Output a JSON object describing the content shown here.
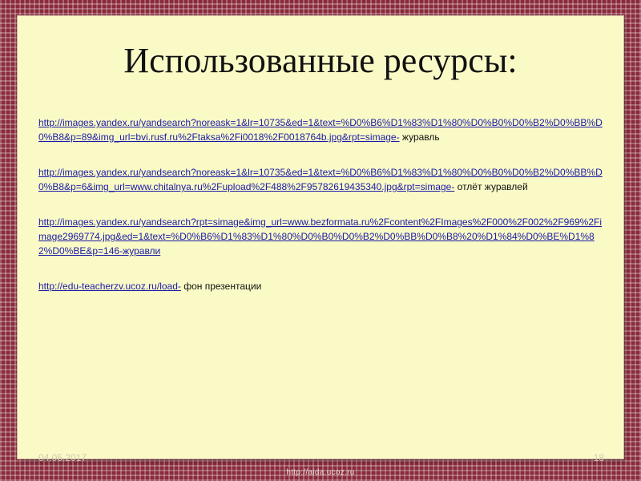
{
  "slide": {
    "title": "Использованные ресурсы:",
    "entries": [
      {
        "url": "http://images.yandex.ru/yandsearch?noreask=1&lr=10735&ed=1&text=%D0%B6%D1%83%D1%80%D0%B0%D0%B2%D0%BB%D0%B8&p=89&img_url=bvi.rusf.ru%2Ftaksa%2Fi0018%2F0018764b.jpg&rpt=simage-",
        "desc": " журавль"
      },
      {
        "url": "http://images.yandex.ru/yandsearch?noreask=1&lr=10735&ed=1&text=%D0%B6%D1%83%D1%80%D0%B0%D0%B2%D0%BB%D0%B8&p=6&img_url=www.chitalnya.ru%2Fupload%2F488%2F95782619435340.jpg&rpt=simage-",
        "desc": " отлёт журавлей"
      },
      {
        "url": "http://images.yandex.ru/yandsearch?rpt=simage&img_url=www.bezformata.ru%2Fcontent%2FImages%2F000%2F002%2F969%2Fimage2969774.jpg&ed=1&text=%D0%B6%D1%83%D1%80%D0%B0%D0%B2%D0%BB%D0%B8%20%D1%84%D0%BE%D1%82%D0%BE&p=146-журавли",
        "desc": ""
      },
      {
        "url": "http://edu-teacherzv.ucoz.ru/load-",
        "desc": " фон презентации"
      }
    ],
    "footer_date": "04.05.2017",
    "slide_number": "18",
    "watermark": "http://aida.ucoz.ru"
  },
  "colors": {
    "slide_bg": "#fafac7",
    "link": "#1a1aa8",
    "frame": "#8a2a3c"
  }
}
